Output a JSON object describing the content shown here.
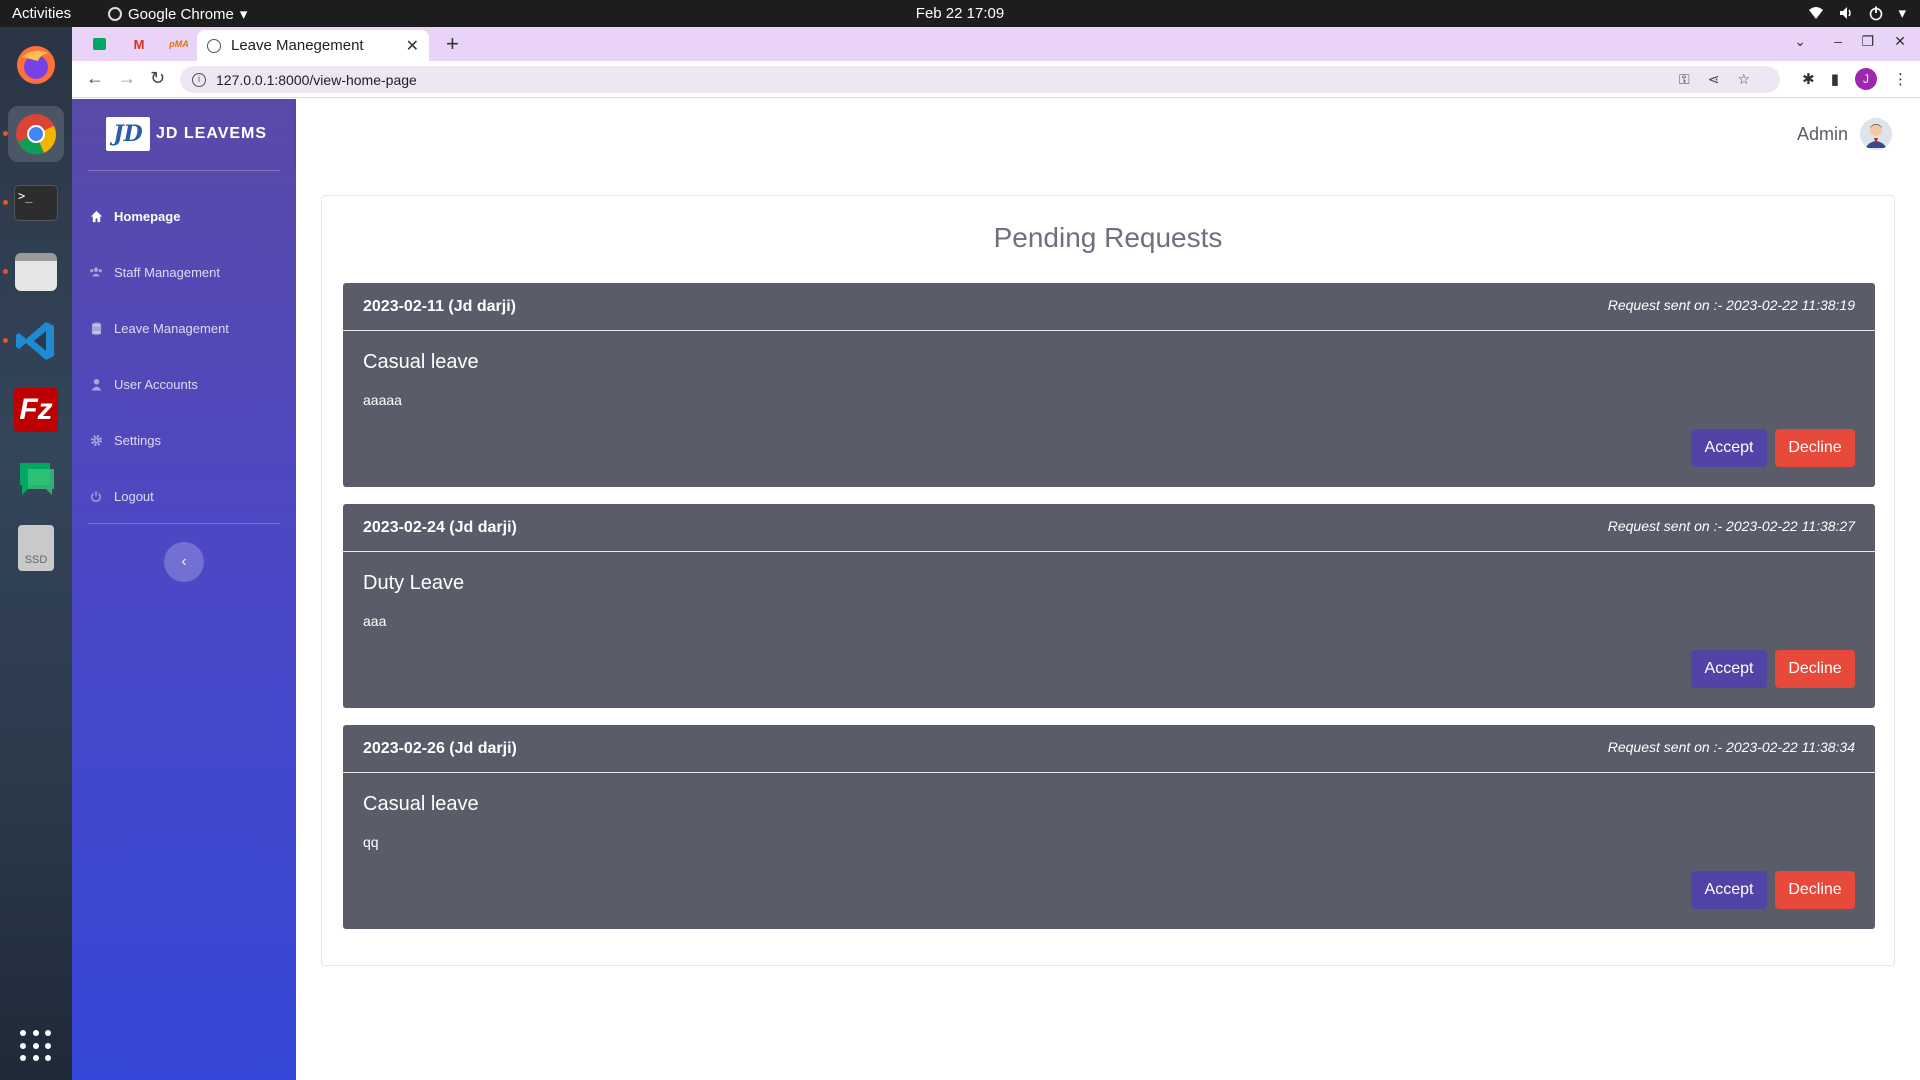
{
  "os": {
    "activities": "Activities",
    "app_menu": "Google Chrome",
    "clock": "Feb 22  17:09"
  },
  "dock": {
    "items": [
      "firefox-icon",
      "chrome-icon",
      "terminal-icon",
      "files-icon",
      "vscode-icon",
      "filezilla-icon",
      "chat-icon",
      "ssd-drive-icon"
    ],
    "ssd_label": "SSD"
  },
  "browser": {
    "active_tab_title": "Leave Manegement",
    "url": "127.0.0.1:8000/view-home-page",
    "profile_initial": "J",
    "pinned_tabs": [
      "chat-tab-icon",
      "gmail-tab-icon",
      "pma-tab-icon"
    ],
    "pma_label": "pMA",
    "gmail_label": "M"
  },
  "sidebar": {
    "brand_logo": "JD",
    "brand": "JD LEAVEMS",
    "items": [
      {
        "label": "Homepage",
        "icon": "home-icon",
        "active": true
      },
      {
        "label": "Staff Management",
        "icon": "users-icon",
        "active": false
      },
      {
        "label": "Leave Management",
        "icon": "database-icon",
        "active": false
      },
      {
        "label": "User Accounts",
        "icon": "user-icon",
        "active": false
      },
      {
        "label": "Settings",
        "icon": "gear-icon",
        "active": false
      },
      {
        "label": "Logout",
        "icon": "power-icon",
        "active": false
      }
    ],
    "toggle": "‹"
  },
  "header": {
    "user_name": "Admin"
  },
  "main": {
    "title": "Pending Requests",
    "accept_label": "Accept",
    "decline_label": "Decline",
    "requests": [
      {
        "date": "2023-02-11 (Jd darji)",
        "sent": "Request sent on :- 2023-02-22 11:38:19",
        "type": "Casual leave",
        "note": "aaaaa"
      },
      {
        "date": "2023-02-24 (Jd darji)",
        "sent": "Request sent on :- 2023-02-22 11:38:27",
        "type": "Duty Leave",
        "note": "aaa"
      },
      {
        "date": "2023-02-26 (Jd darji)",
        "sent": "Request sent on :- 2023-02-22 11:38:34",
        "type": "Casual leave",
        "note": "qq"
      }
    ]
  },
  "colors": {
    "card_bg": "#5a5c69",
    "accept": "#5244a6",
    "decline": "#e74a3b",
    "sidebar_top": "#5a4aa8",
    "sidebar_bottom": "#3547d8"
  }
}
